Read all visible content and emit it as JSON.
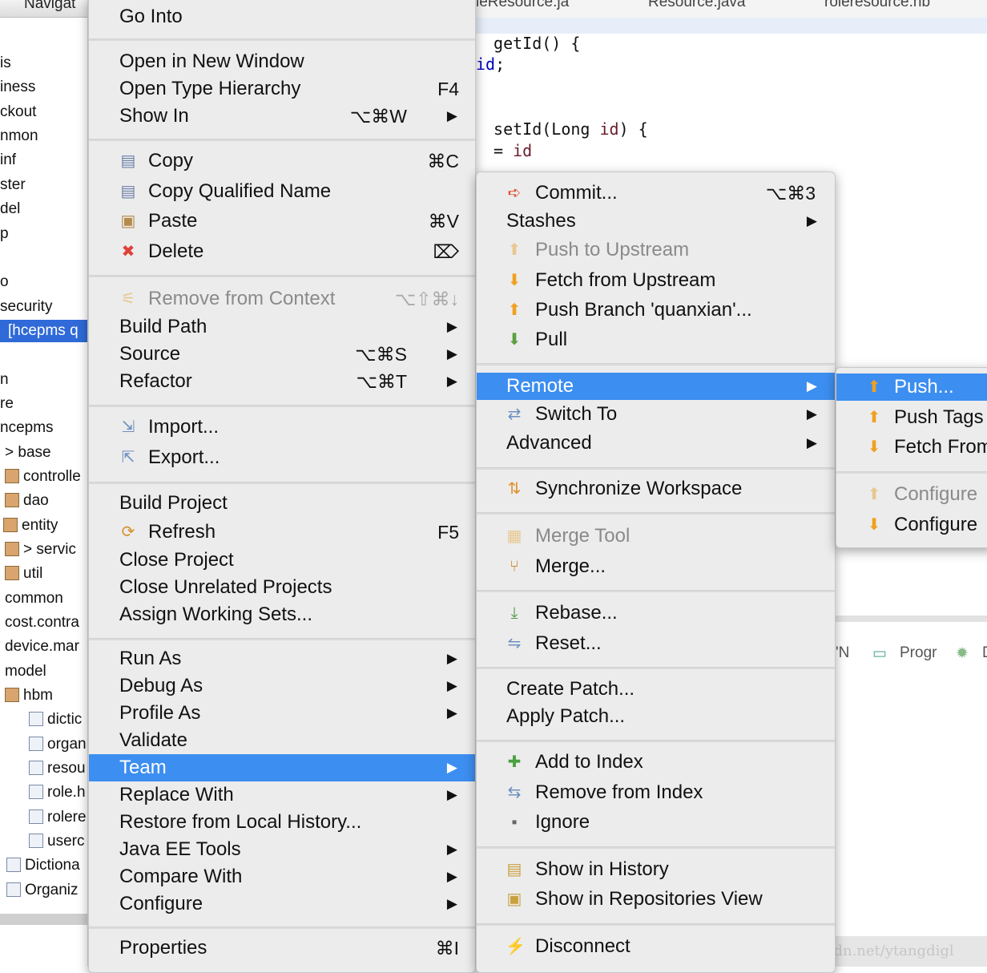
{
  "navigator": {
    "title": "Navigat",
    "items": [
      {
        "label": "is"
      },
      {
        "label": "iness"
      },
      {
        "label": "ckout"
      },
      {
        "label": "nmon"
      },
      {
        "label": "inf"
      },
      {
        "label": "ster"
      },
      {
        "label": "del"
      },
      {
        "label": "p"
      },
      {
        "label": "o"
      },
      {
        "label": "security"
      },
      {
        "label": "[hcepms q",
        "selected": true
      },
      {
        "label": "n"
      },
      {
        "label": "re"
      },
      {
        "label": "ncepms"
      },
      {
        "label": "> base"
      },
      {
        "label": "controlle",
        "icon": "package-icon"
      },
      {
        "label": "dao",
        "icon": "package-icon"
      },
      {
        "label": "entity",
        "icon": "package-warning-icon"
      },
      {
        "label": "> servic",
        "icon": "package-icon"
      },
      {
        "label": "util",
        "icon": "package-icon"
      },
      {
        "label": "common"
      },
      {
        "label": "cost.contra"
      },
      {
        "label": "device.mar"
      },
      {
        "label": "model"
      },
      {
        "label": "hbm",
        "icon": "package-icon"
      },
      {
        "label": "dictic",
        "icon": "xml-file-icon"
      },
      {
        "label": "organ",
        "icon": "xml-file-icon"
      },
      {
        "label": "resou",
        "icon": "xml-file-icon"
      },
      {
        "label": "role.h",
        "icon": "xml-file-icon"
      },
      {
        "label": "rolere",
        "icon": "xml-file-icon"
      },
      {
        "label": "userc",
        "icon": "xml-file-icon"
      },
      {
        "label": "Dictiona",
        "icon": "java-file-icon"
      },
      {
        "label": "Organiz",
        "icon": "java-file-icon"
      }
    ]
  },
  "editor": {
    "tabs": [
      {
        "label": "leResource.ja"
      },
      {
        "label": "Resource.java"
      },
      {
        "label": "roleresource.hb"
      }
    ],
    "code": {
      "l1": " getId() {",
      "l2a": "id",
      ";": ";",
      "l3": " setId(Long ",
      "l3b": "id",
      ") {": ") {",
      "l4a": " = ",
      "l4b": "id"
    }
  },
  "bottom_tabs": [
    {
      "label": "'N"
    },
    {
      "label": "Progr"
    },
    {
      "label": "D"
    }
  ],
  "watermark": "http://blog.csdn.net/ytangdigl",
  "context_menu": [
    {
      "label": "Go Into"
    },
    {
      "sep": true
    },
    {
      "label": "Open in New Window"
    },
    {
      "label": "Open Type Hierarchy",
      "shortcut": "F4"
    },
    {
      "label": "Show In",
      "shortcut": "⌥⌘W",
      "submenu": true
    },
    {
      "sep": true
    },
    {
      "label": "Copy",
      "shortcut": "⌘C",
      "icon": "copy-icon"
    },
    {
      "label": "Copy Qualified Name",
      "icon": "copy-qualified-icon"
    },
    {
      "label": "Paste",
      "shortcut": "⌘V",
      "icon": "paste-icon"
    },
    {
      "label": "Delete",
      "shortcut": "⌦",
      "icon": "delete-icon"
    },
    {
      "sep": true
    },
    {
      "label": "Remove from Context",
      "shortcut": "⌥⇧⌘↓",
      "icon": "remove-context-icon",
      "disabled": true
    },
    {
      "label": "Build Path",
      "submenu": true
    },
    {
      "label": "Source",
      "shortcut": "⌥⌘S",
      "submenu": true
    },
    {
      "label": "Refactor",
      "shortcut": "⌥⌘T",
      "submenu": true
    },
    {
      "sep": true
    },
    {
      "label": "Import...",
      "icon": "import-icon"
    },
    {
      "label": "Export...",
      "icon": "export-icon"
    },
    {
      "sep": true
    },
    {
      "label": "Build Project"
    },
    {
      "label": "Refresh",
      "shortcut": "F5",
      "icon": "refresh-icon"
    },
    {
      "label": "Close Project"
    },
    {
      "label": "Close Unrelated Projects"
    },
    {
      "label": "Assign Working Sets..."
    },
    {
      "sep": true
    },
    {
      "label": "Run As",
      "submenu": true
    },
    {
      "label": "Debug As",
      "submenu": true
    },
    {
      "label": "Profile As",
      "submenu": true
    },
    {
      "label": "Validate"
    },
    {
      "label": "Team",
      "submenu": true,
      "highlighted": true
    },
    {
      "label": "Replace With",
      "submenu": true
    },
    {
      "label": "Restore from Local History..."
    },
    {
      "label": "Java EE Tools",
      "submenu": true
    },
    {
      "label": "Compare With",
      "submenu": true
    },
    {
      "label": "Configure",
      "submenu": true
    },
    {
      "sep": true
    },
    {
      "label": "Properties",
      "shortcut": "⌘I"
    }
  ],
  "team_menu": [
    {
      "label": "Commit...",
      "shortcut": "⌥⌘3",
      "icon": "commit-icon"
    },
    {
      "label": "Stashes",
      "submenu": true
    },
    {
      "label": "Push to Upstream",
      "icon": "push-icon",
      "disabled": true
    },
    {
      "label": "Fetch from Upstream",
      "icon": "fetch-icon"
    },
    {
      "label": "Push Branch 'quanxian'...",
      "icon": "push-icon"
    },
    {
      "label": "Pull",
      "icon": "pull-icon"
    },
    {
      "sep": true
    },
    {
      "label": "Remote",
      "submenu": true,
      "highlighted": true
    },
    {
      "label": "Switch To",
      "submenu": true,
      "icon": "switch-icon"
    },
    {
      "label": "Advanced",
      "submenu": true
    },
    {
      "sep": true
    },
    {
      "label": "Synchronize Workspace",
      "icon": "synchronize-icon"
    },
    {
      "sep": true
    },
    {
      "label": "Merge Tool",
      "icon": "merge-tool-icon",
      "disabled": true
    },
    {
      "label": "Merge...",
      "icon": "merge-icon"
    },
    {
      "sep": true
    },
    {
      "label": "Rebase...",
      "icon": "rebase-icon"
    },
    {
      "label": "Reset...",
      "icon": "reset-icon"
    },
    {
      "sep": true
    },
    {
      "label": "Create Patch..."
    },
    {
      "label": "Apply Patch..."
    },
    {
      "sep": true
    },
    {
      "label": "Add to Index",
      "icon": "add-icon"
    },
    {
      "label": "Remove from Index",
      "icon": "remove-index-icon"
    },
    {
      "label": "Ignore",
      "icon": "ignore-icon"
    },
    {
      "sep": true
    },
    {
      "label": "Show in History",
      "icon": "history-icon"
    },
    {
      "label": "Show in Repositories View",
      "icon": "repositories-icon"
    },
    {
      "sep": true
    },
    {
      "label": "Disconnect",
      "icon": "disconnect-icon"
    }
  ],
  "remote_menu": [
    {
      "label": "Push...",
      "icon": "push-icon",
      "highlighted": true
    },
    {
      "label": "Push Tags",
      "icon": "push-icon"
    },
    {
      "label": "Fetch From",
      "icon": "fetch-icon"
    },
    {
      "sep": true
    },
    {
      "label": "Configure",
      "icon": "push-icon",
      "disabled": true
    },
    {
      "label": "Configure",
      "icon": "fetch-icon"
    }
  ],
  "colors": {
    "highlight": "#3c8ef0",
    "selection": "#2f6ad8",
    "menu_bg": "#ececec"
  }
}
